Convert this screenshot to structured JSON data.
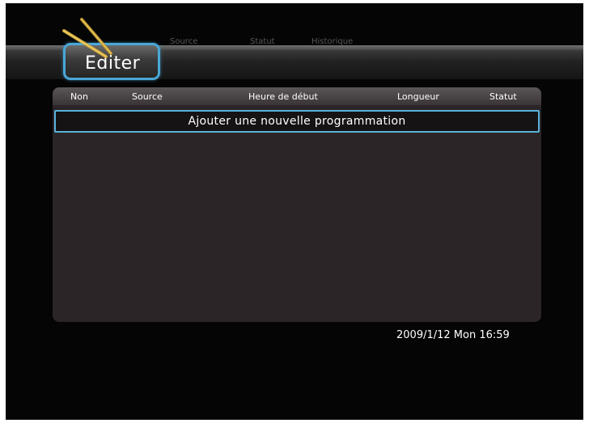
{
  "menu": {
    "active_tab": "Editer",
    "tabs": [
      "Source",
      "Statut",
      "Historique"
    ]
  },
  "table": {
    "columns": [
      "Non",
      "Source",
      "Heure de début",
      "Longueur",
      "Statut"
    ],
    "add_row_label": "Ajouter une nouvelle programmation",
    "rows": []
  },
  "status_bar": {
    "datetime": "2009/1/12 Mon 16:59"
  },
  "colors": {
    "background": "#050505",
    "accent": "#4aa7d6",
    "panel": "#2b2527"
  },
  "icons": {
    "menu_logo": "pencil-icon"
  }
}
